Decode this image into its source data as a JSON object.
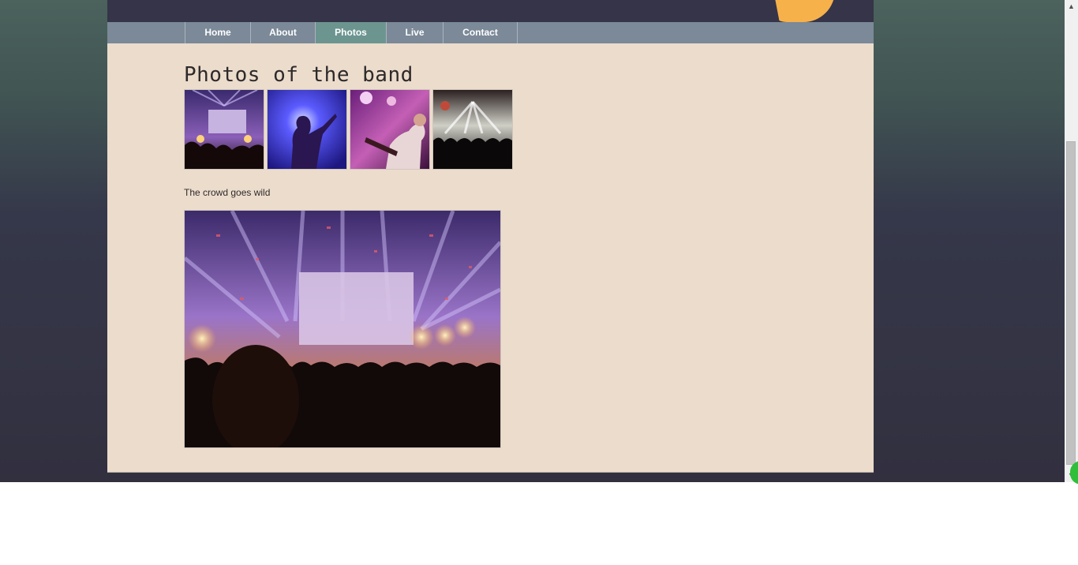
{
  "nav": {
    "items": [
      {
        "label": "Home"
      },
      {
        "label": "About"
      },
      {
        "label": "Photos"
      },
      {
        "label": "Live"
      },
      {
        "label": "Contact"
      }
    ],
    "active": "Photos"
  },
  "main": {
    "title": "Photos of the band",
    "thumbnails": [
      {
        "alt": "concert-stage-screen"
      },
      {
        "alt": "guitarist-silhouette-blue"
      },
      {
        "alt": "guitarist-pink-lights"
      },
      {
        "alt": "crowd-white-lights"
      }
    ],
    "caption": "The crowd goes wild"
  },
  "colors": {
    "header": "#353448",
    "nav": "#7b8998",
    "nav_active": "#6d9590",
    "content": "#ecdccc",
    "ornament": "#f7b14b"
  }
}
